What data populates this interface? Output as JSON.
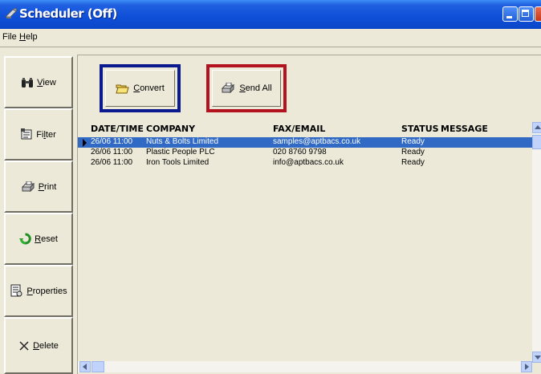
{
  "window": {
    "title": "Scheduler (Off)",
    "titlebar_color": "#0a46c8"
  },
  "menu": {
    "file": "File",
    "help_prefix": "",
    "help_key": "H",
    "help_rest": "elp"
  },
  "sidebar": {
    "items": [
      {
        "key": "V",
        "rest": "iew",
        "icon": "binoculars-icon"
      },
      {
        "pre": "Fi",
        "key": "l",
        "rest": "ter",
        "icon": "filter-icon"
      },
      {
        "key": "P",
        "rest": "rint",
        "icon": "printer-icon"
      },
      {
        "key": "R",
        "rest": "eset",
        "icon": "reset-icon"
      },
      {
        "key": "P",
        "rest": "roperties",
        "icon": "properties-icon"
      },
      {
        "key": "D",
        "rest": "elete",
        "icon": "delete-icon"
      }
    ]
  },
  "toolbar": {
    "convert_key": "C",
    "convert_rest": "onvert",
    "convert_border": "#0b1a8e",
    "send_key": "S",
    "send_rest": "end All",
    "send_border": "#b3131e"
  },
  "list": {
    "columns": [
      "DATE/TIME",
      "COMPANY",
      "FAX/EMAIL",
      "STATUS",
      "MESSAGE"
    ],
    "rows": [
      {
        "datetime": "26/06 11:00",
        "company": "Nuts & Bolts Limited",
        "fax_email": "samples@aptbacs.co.uk",
        "status": "Ready",
        "message": "",
        "selected": true
      },
      {
        "datetime": "26/06 11:00",
        "company": "Plastic People PLC",
        "fax_email": "020 8760 9798",
        "status": "Ready",
        "message": "",
        "selected": false
      },
      {
        "datetime": "26/06 11:00",
        "company": "Iron Tools Limited",
        "fax_email": "info@aptbacs.co.uk",
        "status": "Ready",
        "message": "",
        "selected": false
      }
    ],
    "selection_color": "#316ac5"
  }
}
